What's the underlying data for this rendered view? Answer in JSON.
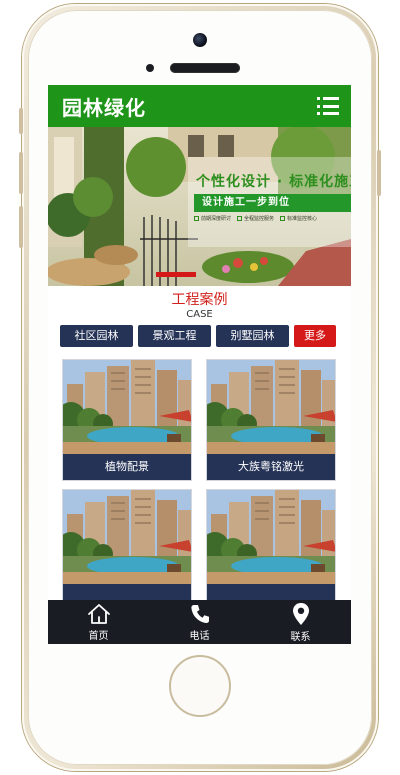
{
  "header": {
    "logo_text": "园林绿化"
  },
  "banner": {
    "headline": "个性化设计 · 标准化施工",
    "strip_text": "设计施工一步到位",
    "features": [
      "前期深度研讨",
      "全程监控服务",
      "标准监控核心"
    ]
  },
  "section": {
    "title_cn": "工程案例",
    "title_en": "CASE"
  },
  "tabs": [
    {
      "label": "社区园林"
    },
    {
      "label": "景观工程"
    },
    {
      "label": "别墅园林"
    }
  ],
  "more_label": "更多",
  "cases": [
    {
      "label": "植物配景"
    },
    {
      "label": "大族粤铭激光"
    },
    {
      "label": ""
    },
    {
      "label": ""
    }
  ],
  "bottom_nav": [
    {
      "label": "首页",
      "icon": "home-icon"
    },
    {
      "label": "电话",
      "icon": "phone-icon"
    },
    {
      "label": "联系",
      "icon": "location-pin-icon"
    }
  ],
  "colors": {
    "brand_green": "#1e9418",
    "navy": "#253357",
    "accent_red": "#d51818",
    "nav_dark": "#1a1c24"
  }
}
